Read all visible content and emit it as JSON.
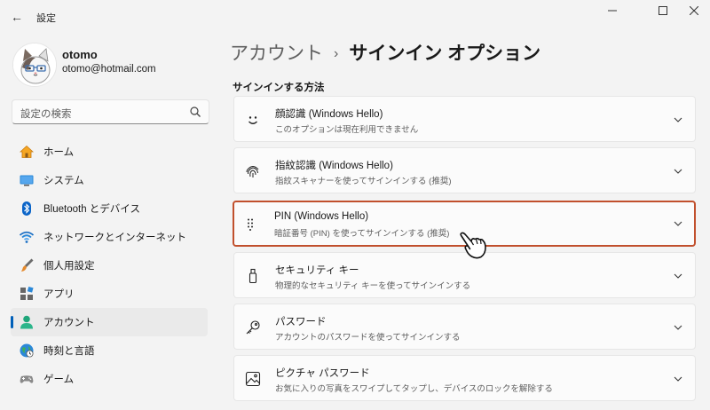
{
  "window": {
    "title": "設定",
    "back_glyph": "←",
    "min_glyph": "—",
    "max_glyph": "☐",
    "close_glyph": "✕"
  },
  "profile": {
    "name": "otomo",
    "email": "otomo@hotmail.com"
  },
  "search": {
    "placeholder": "設定の検索"
  },
  "sidebar": {
    "items": [
      {
        "label": "ホーム",
        "icon": "home-icon"
      },
      {
        "label": "システム",
        "icon": "system-icon"
      },
      {
        "label": "Bluetooth とデバイス",
        "icon": "bluetooth-icon"
      },
      {
        "label": "ネットワークとインターネット",
        "icon": "wifi-icon"
      },
      {
        "label": "個人用設定",
        "icon": "brush-icon"
      },
      {
        "label": "アプリ",
        "icon": "apps-icon"
      },
      {
        "label": "アカウント",
        "icon": "account-icon",
        "selected": true
      },
      {
        "label": "時刻と言語",
        "icon": "globe-icon"
      },
      {
        "label": "ゲーム",
        "icon": "gamepad-icon"
      }
    ]
  },
  "main": {
    "breadcrumb_parent": "アカウント",
    "breadcrumb_sep": "›",
    "breadcrumb_current": "サインイン オプション",
    "section_title": "サインインする方法",
    "options": [
      {
        "title": "顔認識 (Windows Hello)",
        "subtitle": "このオプションは現在利用できません",
        "icon": "face-icon"
      },
      {
        "title": "指紋認識 (Windows Hello)",
        "subtitle": "指紋スキャナーを使ってサインインする (推奨)",
        "icon": "fingerprint-icon"
      },
      {
        "title": "PIN (Windows Hello)",
        "subtitle": "暗証番号 (PIN) を使ってサインインする (推奨)",
        "icon": "pin-keypad-icon",
        "highlighted": true
      },
      {
        "title": "セキュリティ キー",
        "subtitle": "物理的なセキュリティ キーを使ってサインインする",
        "icon": "security-key-icon"
      },
      {
        "title": "パスワード",
        "subtitle": "アカウントのパスワードを使ってサインインする",
        "icon": "key-icon"
      },
      {
        "title": "ピクチャ パスワード",
        "subtitle": "お気に入りの写真をスワイプしてタップし、デバイスのロックを解除する",
        "icon": "picture-password-icon"
      }
    ]
  },
  "colors": {
    "accent": "#005fb8",
    "highlight_border": "#c1502d",
    "background": "#f3f3f3",
    "card": "#fbfbfb"
  }
}
